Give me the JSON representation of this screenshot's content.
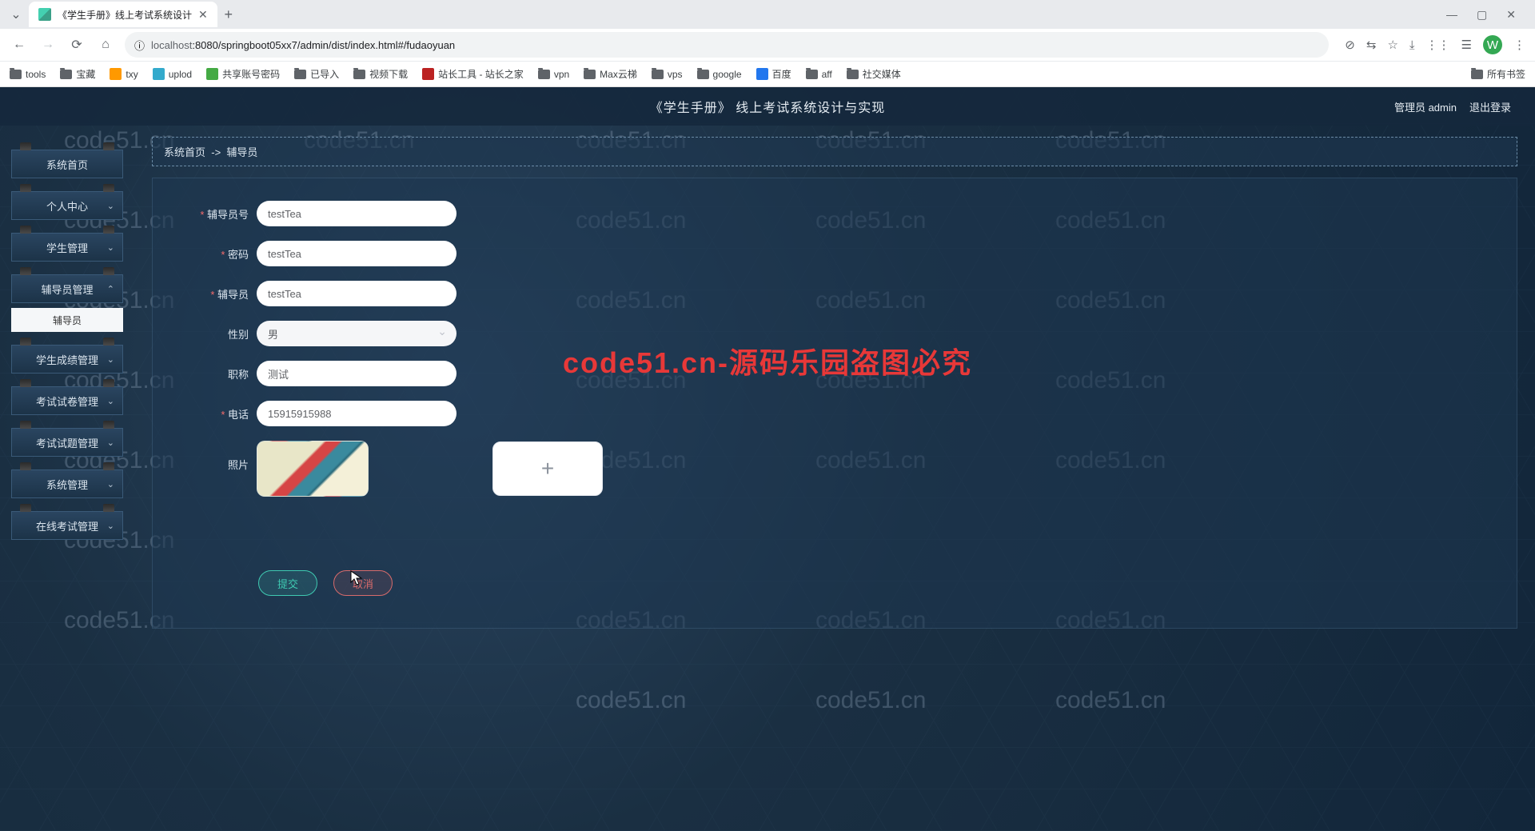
{
  "browser": {
    "tab_title": "《学生手册》线上考试系统设计",
    "url_host": "localhost",
    "url_path": ":8080/springboot05xx7/admin/dist/index.html#/fudaoyuan",
    "avatar_letter": "W",
    "bookmarks": [
      "tools",
      "宝藏",
      "txy",
      "uplod",
      "共享账号密码",
      "已导入",
      "视频下载",
      "站长工具 - 站长之家",
      "vpn",
      "Max云梯",
      "vps",
      "google",
      "百度",
      "aff",
      "社交媒体"
    ],
    "all_bookmarks": "所有书签"
  },
  "app": {
    "title": "《学生手册》 线上考试系统设计与实现",
    "user_label": "管理员 admin",
    "logout": "退出登录"
  },
  "sidebar": {
    "items": [
      {
        "label": "系统首页",
        "chev": false
      },
      {
        "label": "个人中心",
        "chev": true
      },
      {
        "label": "学生管理",
        "chev": true
      },
      {
        "label": "辅导员管理",
        "chev": true,
        "expanded": true,
        "sub": "辅导员"
      },
      {
        "label": "学生成绩管理",
        "chev": true
      },
      {
        "label": "考试试卷管理",
        "chev": true
      },
      {
        "label": "考试试题管理",
        "chev": true
      },
      {
        "label": "系统管理",
        "chev": true
      },
      {
        "label": "在线考试管理",
        "chev": true
      }
    ]
  },
  "breadcrumb": {
    "root": "系统首页",
    "sep": "->",
    "current": "辅导员"
  },
  "form": {
    "fields": {
      "id": {
        "label": "辅导员号",
        "value": "testTea",
        "required": true
      },
      "password": {
        "label": "密码",
        "value": "testTea",
        "required": true
      },
      "name": {
        "label": "辅导员",
        "value": "testTea",
        "required": true
      },
      "gender": {
        "label": "性别",
        "value": "男",
        "required": false
      },
      "title": {
        "label": "职称",
        "value": "测试",
        "required": false
      },
      "phone": {
        "label": "电话",
        "value": "15915915988",
        "required": true
      },
      "photo": {
        "label": "照片"
      }
    },
    "buttons": {
      "submit": "提交",
      "cancel": "取消"
    }
  },
  "watermark": "code51.cn",
  "overlay": "code51.cn-源码乐园盗图必究"
}
